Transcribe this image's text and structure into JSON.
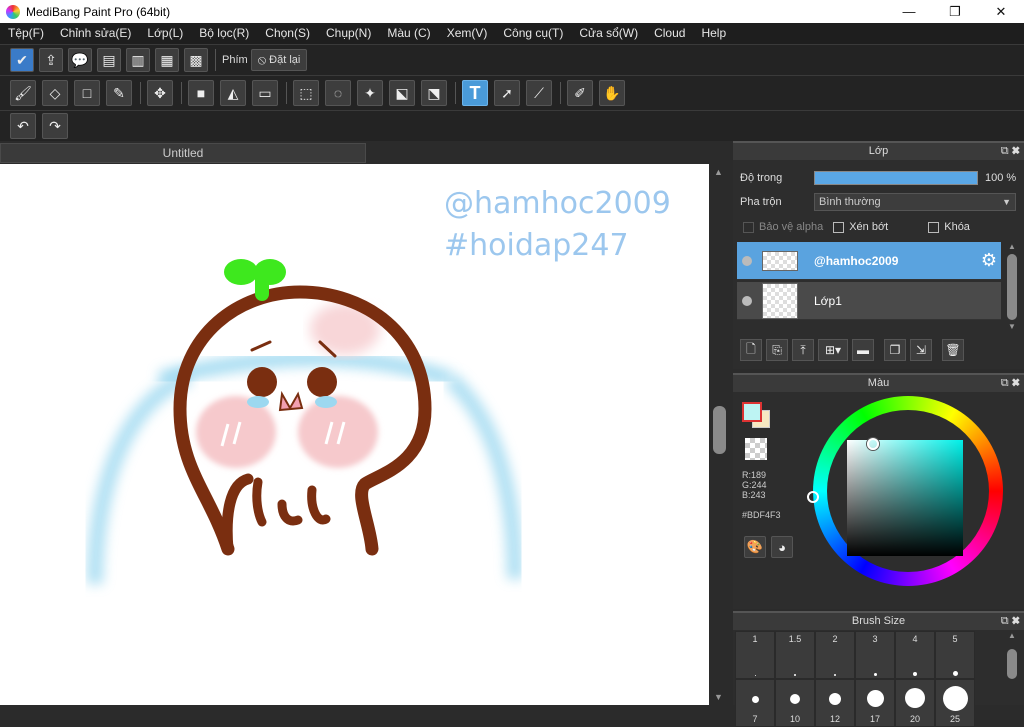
{
  "window": {
    "title": "MediBang Paint Pro (64bit)",
    "minimize": "—",
    "maximize": "❐",
    "close": "✕"
  },
  "menu": [
    "Tệp(F)",
    "Chỉnh sửa(E)",
    "Lớp(L)",
    "Bộ lọc(R)",
    "Chọn(S)",
    "Chụp(N)",
    "Màu (C)",
    "Xem(V)",
    "Công cụ(T)",
    "Cửa sổ(W)",
    "Cloud",
    "Help"
  ],
  "toolbar1": {
    "phim_label": "Phím",
    "reset_label": "Đặt lại"
  },
  "document": {
    "tab_title": "Untitled",
    "watermark_line1": "@hamhoc2009",
    "watermark_line2": "#hoidap247"
  },
  "layers_panel": {
    "title": "Lớp",
    "opacity_label": "Độ trong",
    "opacity_value": "100 %",
    "opacity_percent": 100,
    "blend_label": "Pha trộn",
    "blend_value": "Bình thường",
    "protect_alpha": "Bảo vệ alpha",
    "clipping": "Xén bớt",
    "lock": "Khóa",
    "layers": [
      {
        "name": "@hamhoc2009",
        "selected": true
      },
      {
        "name": "Lớp1",
        "selected": false
      }
    ]
  },
  "color_panel": {
    "title": "Màu",
    "r": "R:189",
    "g": "G:244",
    "b": "B:243",
    "hex": "#BDF4F3",
    "current_color": "#BDF4F3"
  },
  "brush_panel": {
    "title": "Brush Size",
    "sizes": [
      "1",
      "1.5",
      "2",
      "3",
      "4",
      "5",
      "7",
      "10",
      "12",
      "17",
      "20",
      "25"
    ]
  },
  "colors": {
    "accent": "#5AA3DF",
    "stroke_brown": "#7A2E10",
    "sprout_green": "#3EE81E",
    "tear_blue": "#9CD8F0",
    "blush_pink": "#F6C9CC"
  }
}
